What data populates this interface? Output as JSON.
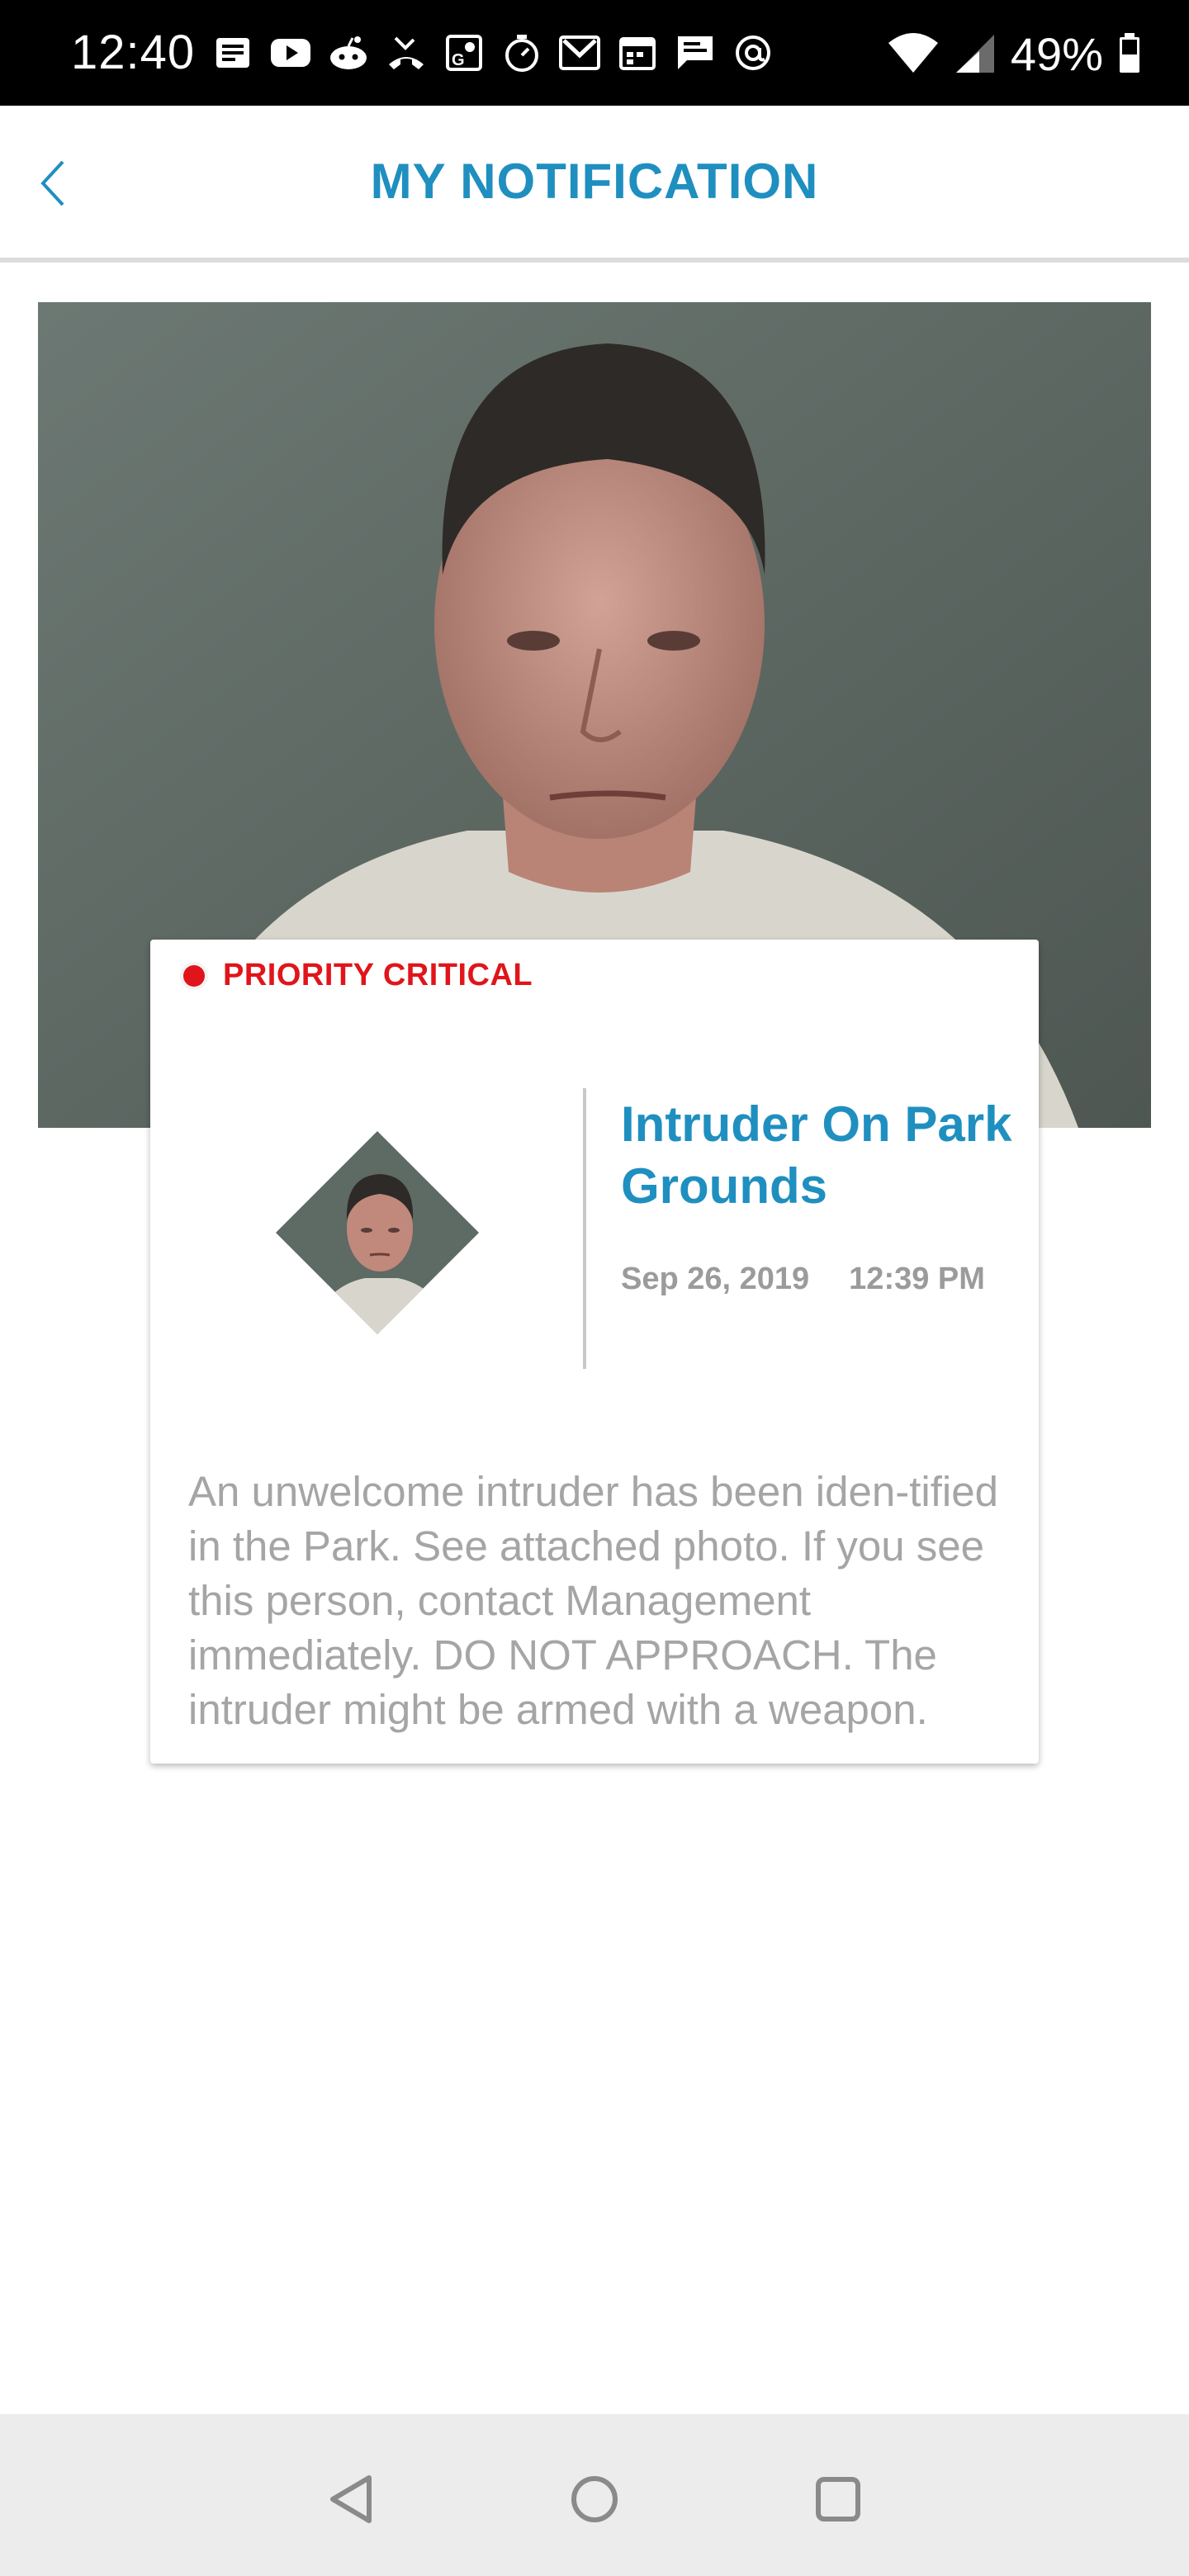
{
  "status_bar": {
    "time": "12:40",
    "battery_percent": "49%",
    "notification_icons": [
      "news-icon",
      "youtube-icon",
      "reddit-icon",
      "missed-call-icon",
      "maps-icon",
      "timer-icon",
      "gmail-icon",
      "calendar-icon",
      "chat-icon",
      "at-sign-icon"
    ]
  },
  "header": {
    "title": "MY NOTIFICATION",
    "back_icon": "chevron-left-icon"
  },
  "notification": {
    "priority_label": "PRIORITY CRITICAL",
    "title": "Intruder On Park Grounds",
    "date": "Sep 26, 2019",
    "time": "12:39 PM",
    "body": "An unwelcome intruder has been iden-tified in the Park. See attached photo. If you see this person, contact Management immediately. DO NOT APPROACH. The intruder might be armed with a weapon."
  },
  "colors": {
    "accent": "#1f8fc0",
    "priority": "#e0151b",
    "muted_text": "#a5a5a5"
  },
  "nav_bar": {
    "buttons": [
      "back-triangle-icon",
      "home-circle-icon",
      "recents-square-icon"
    ]
  }
}
